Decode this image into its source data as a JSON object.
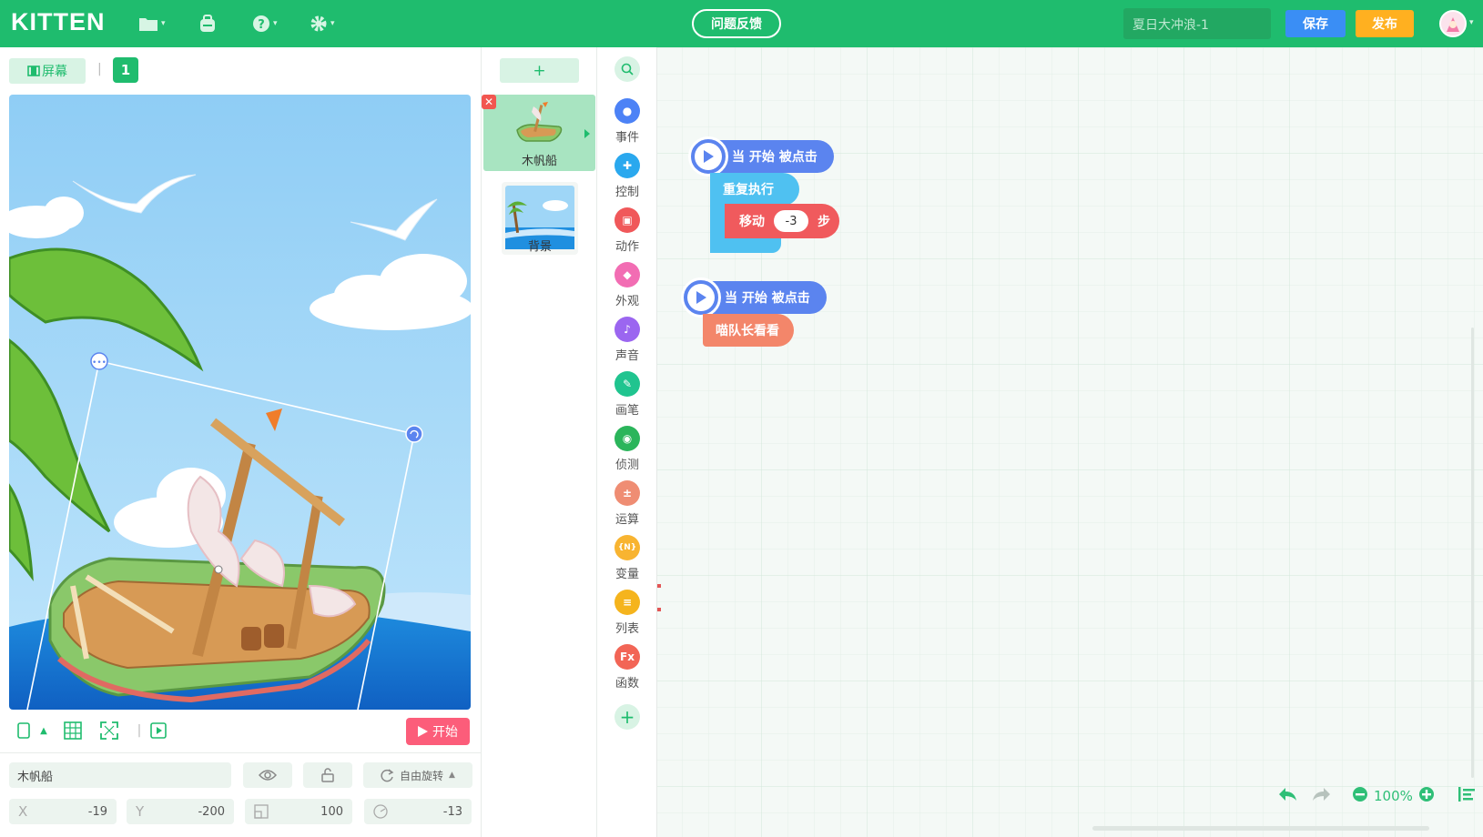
{
  "app": {
    "logo": "KITTEN",
    "feedback_label": "问题反馈",
    "project_name": "夏日大冲浪-1",
    "save_label": "保存",
    "publish_label": "发布",
    "menu_icons": [
      "folder-icon",
      "backpack-icon",
      "help-icon",
      "settings-icon"
    ]
  },
  "stage": {
    "screen_label": "屏幕",
    "screen_number": "1",
    "run_label": "开始",
    "toolbar_icons": [
      "screen-ratio-icon",
      "grid-icon",
      "fullscreen-icon",
      "phone-preview-icon"
    ]
  },
  "sprite_props": {
    "name": "木帆船",
    "rotation_mode": "自由旋转",
    "x_label": "X",
    "x_value": "-19",
    "y_label": "Y",
    "y_value": "-200",
    "size_value": "100",
    "direction_value": "-13"
  },
  "sprites": {
    "add_label": "+",
    "items": [
      {
        "name": "木帆船"
      }
    ],
    "background_label": "背景"
  },
  "categories": [
    {
      "label": "事件",
      "color": "#4c82f6",
      "icon": "event-icon"
    },
    {
      "label": "控制",
      "color": "#2aa8ee",
      "icon": "control-icon"
    },
    {
      "label": "动作",
      "color": "#f0585a",
      "icon": "motion-icon"
    },
    {
      "label": "外观",
      "color": "#f26db3",
      "icon": "looks-icon"
    },
    {
      "label": "声音",
      "color": "#9b66f0",
      "icon": "sound-icon"
    },
    {
      "label": "画笔",
      "color": "#20c48f",
      "icon": "pen-icon"
    },
    {
      "label": "侦测",
      "color": "#2bb55b",
      "icon": "sensing-icon"
    },
    {
      "label": "运算",
      "color": "#ef8d73",
      "icon": "operator-icon"
    },
    {
      "label": "变量",
      "color": "#f8b431",
      "icon": "variable-icon"
    },
    {
      "label": "列表",
      "color": "#f5b41d",
      "icon": "list-icon"
    },
    {
      "label": "函数",
      "color": "#f26556",
      "icon": "function-icon"
    }
  ],
  "script1": {
    "hat_label": "当 开始 被点击",
    "repeat_label": "重复执行",
    "move_label": "移动",
    "move_value": "-3",
    "move_unit": "步"
  },
  "script2": {
    "hat_label": "当 开始 被点击",
    "block_label": "喵队长看看"
  },
  "workspace": {
    "zoom": "100%"
  }
}
